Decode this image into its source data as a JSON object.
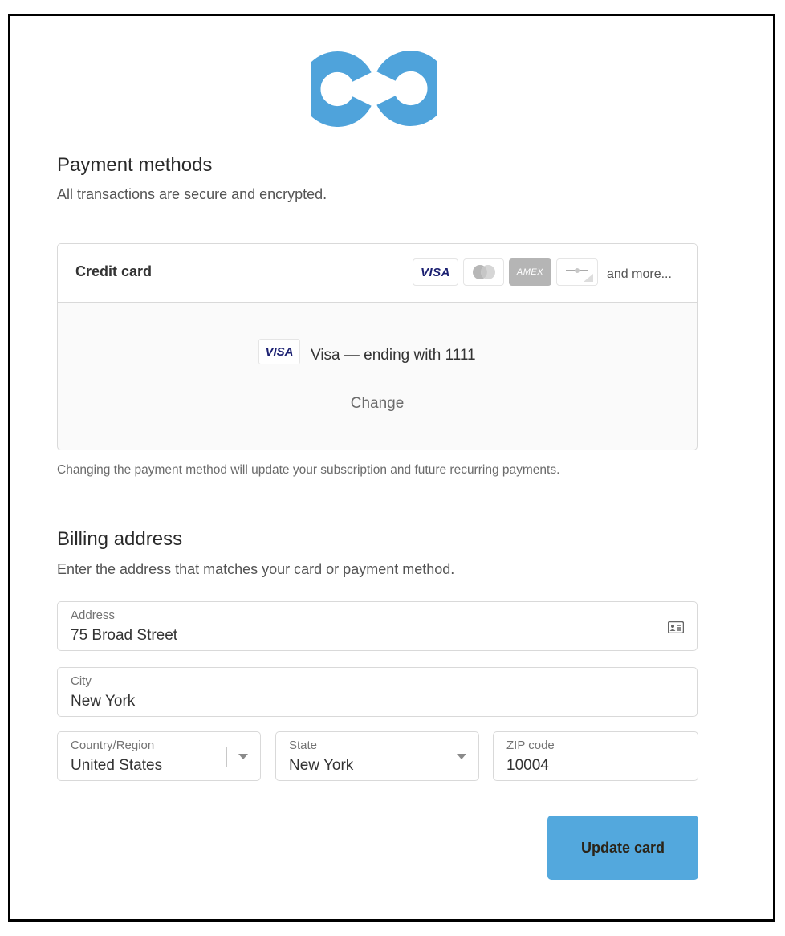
{
  "payment": {
    "title": "Payment methods",
    "subtitle": "All transactions are secure and encrypted.",
    "method_label": "Credit card",
    "card_badges": {
      "visa": "VISA",
      "mastercard_icon": "mastercard-icon",
      "amex": "AMEX",
      "generic_icon": "generic-card-icon"
    },
    "and_more": "and more...",
    "selected_badge": "VISA",
    "selected_card": "Visa — ending with 1111",
    "change_link": "Change",
    "note": "Changing the payment method will update your subscription and future recurring payments."
  },
  "billing": {
    "title": "Billing address",
    "subtitle": "Enter the address that matches your card or payment method.",
    "address_label": "Address",
    "address_value": "75 Broad Street",
    "city_label": "City",
    "city_value": "New York",
    "country_label": "Country/Region",
    "country_value": "United States",
    "state_label": "State",
    "state_value": "New York",
    "zip_label": "ZIP code",
    "zip_value": "10004"
  },
  "submit_label": "Update card",
  "colors": {
    "accent": "#53a8dd",
    "logo": "#4fa3db",
    "visa_text": "#1a1f71"
  }
}
